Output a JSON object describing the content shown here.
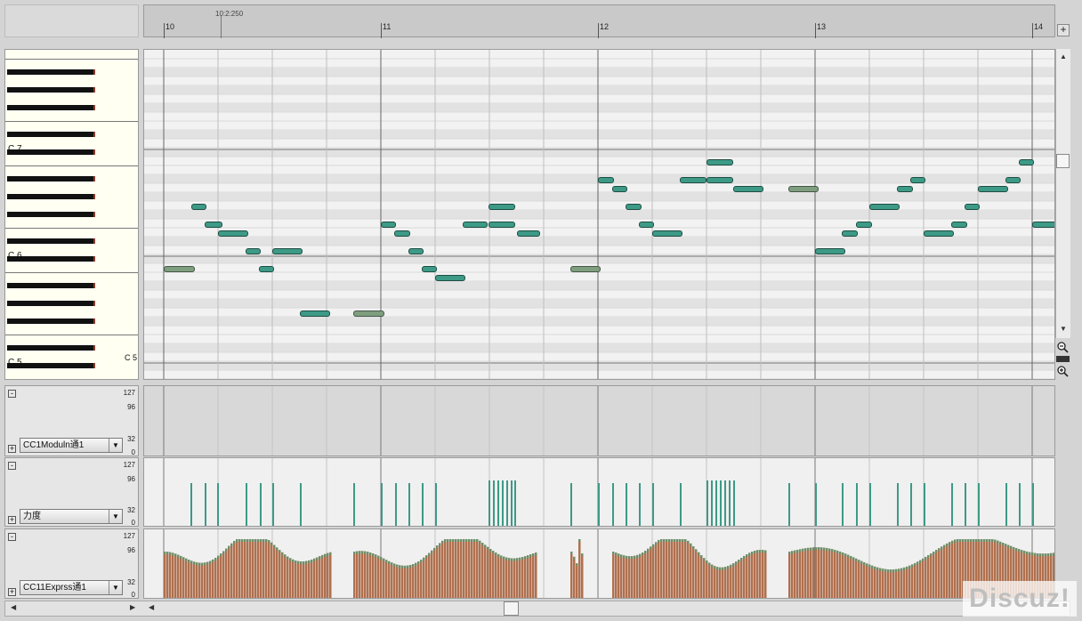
{
  "ruler": {
    "position_label": "10:2:250",
    "measures": [
      "10",
      "11",
      "12",
      "13",
      "14"
    ]
  },
  "piano": {
    "octave_labels": [
      "C 7",
      "C 6",
      "C 5"
    ],
    "right_label": "C 5"
  },
  "lanes": [
    {
      "controller": "CC1Moduln通1",
      "scale": [
        "127",
        "96",
        "32",
        "0"
      ]
    },
    {
      "controller": "力度",
      "scale": [
        "127",
        "96",
        "32",
        "0"
      ]
    },
    {
      "controller": "CC11Exprss通1",
      "scale": [
        "127",
        "96",
        "32",
        "0"
      ]
    }
  ],
  "watermark": "Discuz!",
  "icons": {
    "add": "plus-icon",
    "zoom_out": "zoom-out-icon",
    "zoom_in": "zoom-in-icon",
    "scroll_up": "scroll-up-arrow-icon",
    "scroll_down": "scroll-down-arrow-icon",
    "scroll_left": "scroll-left-arrow-icon",
    "scroll_right": "scroll-right-arrow-icon"
  },
  "colors": {
    "note": "#3d9a86",
    "note_selected": "#7f9e7e",
    "velocity": "#3d9a86",
    "expression": "#b0704e",
    "expression_top": "#6f8f6a"
  }
}
